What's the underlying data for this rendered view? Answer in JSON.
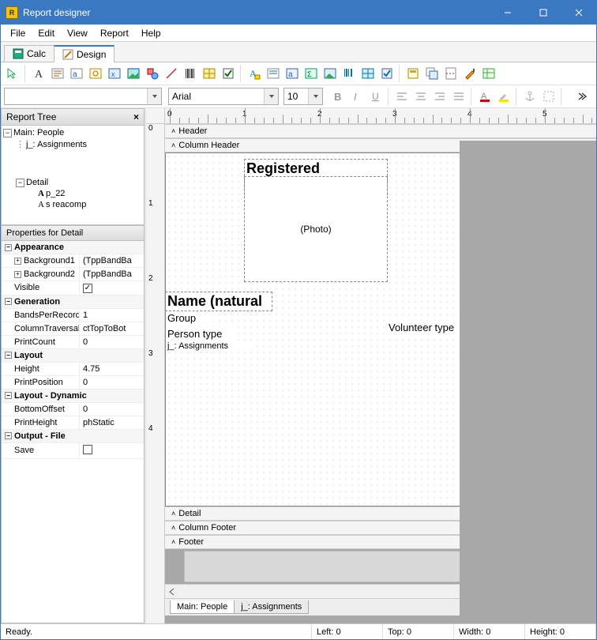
{
  "window": {
    "title": "Report designer"
  },
  "menu": [
    "File",
    "Edit",
    "View",
    "Report",
    "Help"
  ],
  "topTabs": [
    {
      "label": "Calc",
      "active": false
    },
    {
      "label": "Design",
      "active": true
    }
  ],
  "toolbar2": {
    "fontName": "Arial",
    "fontSize": "10"
  },
  "reportTree": {
    "title": "Report Tree",
    "nodes": {
      "root": "Main: People",
      "child1": "j_: Assignments",
      "detail": "Detail",
      "p22": "p_22",
      "sreg": "s  reacomp"
    }
  },
  "properties": {
    "header": "Properties for Detail",
    "categories": [
      {
        "name": "Appearance",
        "rows": [
          {
            "name": "Background1",
            "value": "(TppBandBa",
            "expandable": true
          },
          {
            "name": "Background2",
            "value": "(TppBandBa",
            "expandable": true
          },
          {
            "name": "Visible",
            "value": "checked",
            "checkbox": true
          }
        ]
      },
      {
        "name": "Generation",
        "rows": [
          {
            "name": "BandsPerRecord",
            "value": "1"
          },
          {
            "name": "ColumnTraversal",
            "value": "ctTopToBot"
          },
          {
            "name": "PrintCount",
            "value": "0"
          }
        ]
      },
      {
        "name": "Layout",
        "rows": [
          {
            "name": "Height",
            "value": "4.75"
          },
          {
            "name": "PrintPosition",
            "value": "0"
          }
        ]
      },
      {
        "name": "Layout - Dynamic",
        "rows": [
          {
            "name": "BottomOffset",
            "value": "0"
          },
          {
            "name": "PrintHeight",
            "value": "phStatic"
          }
        ]
      },
      {
        "name": "Output - File",
        "rows": [
          {
            "name": "Save",
            "value": "unchecked",
            "checkbox": true
          }
        ]
      }
    ]
  },
  "bands": {
    "header": "Header",
    "colHeader": "Column Header",
    "detail": "Detail",
    "colFooter": "Column Footer",
    "footer": "Footer"
  },
  "designFields": {
    "regCompany": "Registered company",
    "photo": "(Photo)",
    "nameNatural": "Name (natural",
    "group": "Group",
    "personType": "Person type",
    "assignments": "j_: Assignments",
    "volunteerType": "Volunteer type"
  },
  "bottomTabs": [
    "Main: People",
    "j_: Assignments"
  ],
  "ruler": {
    "ticks": [
      "0",
      "1",
      "2",
      "3",
      "4",
      "5"
    ]
  },
  "vruler": {
    "ticks": [
      "0",
      "1",
      "2",
      "3",
      "4"
    ]
  },
  "status": {
    "ready": "Ready.",
    "left": "Left: 0",
    "top": "Top: 0",
    "width": "Width: 0",
    "height": "Height: 0"
  }
}
